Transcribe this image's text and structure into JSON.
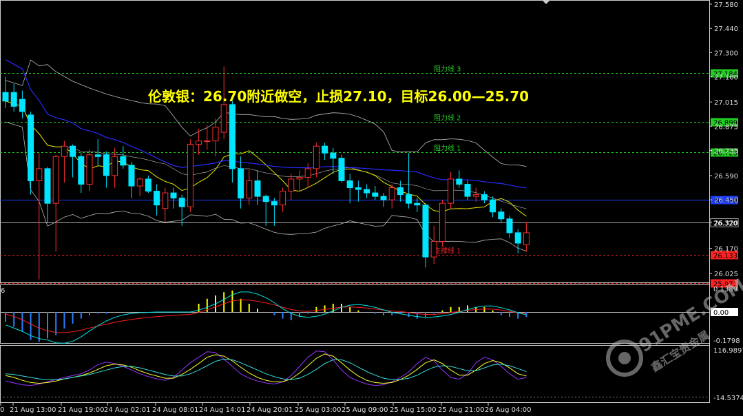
{
  "annotation": {
    "text": "伦敦银：26.70附近做空，止损27.10，目标26.00—25.70",
    "color": "#ffff00"
  },
  "watermark": {
    "brand": "91PME.COM",
    "sub": "鑫汇宝贵金属"
  },
  "price_axis": {
    "ticks": [
      "27.580",
      "27.440",
      "27.300",
      "27.160",
      "27.015",
      "26.875",
      "26.735",
      "26.590",
      "26.450",
      "26.320",
      "26.170",
      "26.025"
    ],
    "tick_values": [
      27.58,
      27.44,
      27.3,
      27.16,
      27.015,
      26.875,
      26.735,
      26.59,
      26.45,
      26.32,
      26.17,
      26.025
    ],
    "range": [
      25.94,
      27.6
    ]
  },
  "levels": [
    {
      "name": "阻力线 3",
      "price": 27.184,
      "badge": "27.184",
      "color": "#22cc22",
      "badge_bg": "#22cc22",
      "style": "dashed"
    },
    {
      "name": "阻力线 2",
      "price": 26.899,
      "badge": "26.899",
      "color": "#22cc22",
      "badge_bg": "#22cc22",
      "style": "dashed"
    },
    {
      "name": "阻力线 1",
      "price": 26.723,
      "badge": "26.723",
      "color": "#22cc22",
      "badge_bg": "#22cc22",
      "style": "dashed"
    },
    {
      "name": "",
      "price": 26.45,
      "badge": "26.450",
      "color": "#1f3fff",
      "badge_bg": "#1f3fff",
      "style": "solid"
    },
    {
      "name": "",
      "price": 26.32,
      "badge": "26.320",
      "color": "#aaaaaa",
      "badge_bg": "#000000",
      "style": "solid"
    },
    {
      "name": "支撑线 1",
      "price": 26.133,
      "badge": "26.133",
      "color": "#ff2222",
      "badge_bg": "#ff2222",
      "style": "dashed"
    },
    {
      "name": "",
      "price": 25.971,
      "badge": "25.971",
      "color": "#ff2222",
      "badge_bg": "#ff2222",
      "style": "dashed"
    }
  ],
  "macd_axis": {
    "top": "0.1389",
    "mid": "0.00",
    "bottom": "-0.1798",
    "left_label": "6"
  },
  "osc_axis": {
    "top": "116.9897",
    "bottom": "-14.5374"
  },
  "time_axis": [
    "0",
    "21 Aug 13:00",
    "21 Aug 19:00",
    "24 Aug 02:01",
    "24 Aug 08:01",
    "24 Aug 14:01",
    "24 Aug 20:01",
    "25 Aug 03:00",
    "25 Aug 09:00",
    "25 Aug 15:00",
    "25 Aug 21:00",
    "26 Aug 04:00"
  ],
  "colors": {
    "bull": "#ff3030",
    "bear": "#00e5ff",
    "ma_fast": "#e6e600",
    "ma_slow": "#2a2aff",
    "bands": "#bbbbbb",
    "macd_pos": "#ffff00",
    "macd_neg": "#2a7fff",
    "signal_red": "#ff2020",
    "signal_cyan": "#00e5e5",
    "osc_purple": "#9933ff",
    "osc_yellow": "#ffff33",
    "osc_cyan": "#33dddd"
  },
  "chart_data": {
    "type": "candlestick",
    "symbol_note": "London silver",
    "candles": [
      {
        "o": 27.07,
        "h": 27.16,
        "l": 26.98,
        "c": 27.02
      },
      {
        "o": 27.07,
        "h": 27.12,
        "l": 26.96,
        "c": 26.99
      },
      {
        "o": 27.03,
        "h": 27.08,
        "l": 26.92,
        "c": 26.96
      },
      {
        "o": 26.94,
        "h": 26.96,
        "l": 26.48,
        "c": 26.56
      },
      {
        "o": 26.56,
        "h": 26.72,
        "l": 25.99,
        "c": 26.63
      },
      {
        "o": 26.63,
        "h": 26.64,
        "l": 26.32,
        "c": 26.43
      },
      {
        "o": 26.43,
        "h": 26.71,
        "l": 26.15,
        "c": 26.7
      },
      {
        "o": 26.7,
        "h": 26.79,
        "l": 26.55,
        "c": 26.76
      },
      {
        "o": 26.76,
        "h": 26.77,
        "l": 26.58,
        "c": 26.7
      },
      {
        "o": 26.7,
        "h": 26.72,
        "l": 26.49,
        "c": 26.54
      },
      {
        "o": 26.54,
        "h": 26.74,
        "l": 26.5,
        "c": 26.71
      },
      {
        "o": 26.71,
        "h": 26.8,
        "l": 26.65,
        "c": 26.7
      },
      {
        "o": 26.71,
        "h": 26.73,
        "l": 26.52,
        "c": 26.59
      },
      {
        "o": 26.59,
        "h": 26.75,
        "l": 26.52,
        "c": 26.7
      },
      {
        "o": 26.7,
        "h": 26.76,
        "l": 26.63,
        "c": 26.65
      },
      {
        "o": 26.65,
        "h": 26.67,
        "l": 26.46,
        "c": 26.53
      },
      {
        "o": 26.53,
        "h": 26.58,
        "l": 26.47,
        "c": 26.57
      },
      {
        "o": 26.57,
        "h": 26.59,
        "l": 26.49,
        "c": 26.5
      },
      {
        "o": 26.5,
        "h": 26.54,
        "l": 26.36,
        "c": 26.42
      },
      {
        "o": 26.4,
        "h": 26.52,
        "l": 26.32,
        "c": 26.49
      },
      {
        "o": 26.49,
        "h": 26.52,
        "l": 26.4,
        "c": 26.46
      },
      {
        "o": 26.46,
        "h": 26.48,
        "l": 26.3,
        "c": 26.41
      },
      {
        "o": 26.41,
        "h": 26.8,
        "l": 26.38,
        "c": 26.77
      },
      {
        "o": 26.77,
        "h": 26.86,
        "l": 26.71,
        "c": 26.79
      },
      {
        "o": 26.79,
        "h": 26.88,
        "l": 26.74,
        "c": 26.79
      },
      {
        "o": 26.79,
        "h": 26.92,
        "l": 26.7,
        "c": 26.87
      },
      {
        "o": 26.84,
        "h": 27.22,
        "l": 26.8,
        "c": 27.0
      },
      {
        "o": 27.0,
        "h": 27.02,
        "l": 26.55,
        "c": 26.63
      },
      {
        "o": 26.63,
        "h": 26.7,
        "l": 26.4,
        "c": 26.46
      },
      {
        "o": 26.46,
        "h": 26.62,
        "l": 26.42,
        "c": 26.56
      },
      {
        "o": 26.56,
        "h": 26.62,
        "l": 26.42,
        "c": 26.47
      },
      {
        "o": 26.47,
        "h": 26.48,
        "l": 26.3,
        "c": 26.44
      },
      {
        "o": 26.44,
        "h": 26.46,
        "l": 26.3,
        "c": 26.42
      },
      {
        "o": 26.42,
        "h": 26.52,
        "l": 26.38,
        "c": 26.5
      },
      {
        "o": 26.5,
        "h": 26.6,
        "l": 26.45,
        "c": 26.57
      },
      {
        "o": 26.57,
        "h": 26.62,
        "l": 26.5,
        "c": 26.58
      },
      {
        "o": 26.58,
        "h": 26.66,
        "l": 26.52,
        "c": 26.63
      },
      {
        "o": 26.63,
        "h": 26.78,
        "l": 26.58,
        "c": 26.76
      },
      {
        "o": 26.76,
        "h": 26.78,
        "l": 26.68,
        "c": 26.72
      },
      {
        "o": 26.72,
        "h": 26.75,
        "l": 26.6,
        "c": 26.69
      },
      {
        "o": 26.69,
        "h": 26.71,
        "l": 26.55,
        "c": 26.56
      },
      {
        "o": 26.56,
        "h": 26.6,
        "l": 26.43,
        "c": 26.52
      },
      {
        "o": 26.52,
        "h": 26.56,
        "l": 26.44,
        "c": 26.51
      },
      {
        "o": 26.51,
        "h": 26.54,
        "l": 26.46,
        "c": 26.49
      },
      {
        "o": 26.49,
        "h": 26.53,
        "l": 26.45,
        "c": 26.47
      },
      {
        "o": 26.47,
        "h": 26.49,
        "l": 26.41,
        "c": 26.45
      },
      {
        "o": 26.45,
        "h": 26.54,
        "l": 26.4,
        "c": 26.52
      },
      {
        "o": 26.52,
        "h": 26.56,
        "l": 26.44,
        "c": 26.48
      },
      {
        "o": 26.48,
        "h": 26.72,
        "l": 26.4,
        "c": 26.43
      },
      {
        "o": 26.43,
        "h": 26.46,
        "l": 26.38,
        "c": 26.42
      },
      {
        "o": 26.42,
        "h": 26.43,
        "l": 26.06,
        "c": 26.12
      },
      {
        "o": 26.12,
        "h": 26.3,
        "l": 26.08,
        "c": 26.21
      },
      {
        "o": 26.21,
        "h": 26.45,
        "l": 26.18,
        "c": 26.43
      },
      {
        "o": 26.43,
        "h": 26.61,
        "l": 26.4,
        "c": 26.57
      },
      {
        "o": 26.57,
        "h": 26.62,
        "l": 26.52,
        "c": 26.54
      },
      {
        "o": 26.54,
        "h": 26.56,
        "l": 26.45,
        "c": 26.47
      },
      {
        "o": 26.47,
        "h": 26.52,
        "l": 26.44,
        "c": 26.48
      },
      {
        "o": 26.48,
        "h": 26.5,
        "l": 26.43,
        "c": 26.45
      },
      {
        "o": 26.45,
        "h": 26.47,
        "l": 26.35,
        "c": 26.38
      },
      {
        "o": 26.38,
        "h": 26.4,
        "l": 26.32,
        "c": 26.34
      },
      {
        "o": 26.34,
        "h": 26.36,
        "l": 26.23,
        "c": 26.26
      },
      {
        "o": 26.26,
        "h": 26.28,
        "l": 26.14,
        "c": 26.2
      },
      {
        "o": 26.19,
        "h": 26.32,
        "l": 26.15,
        "c": 26.26
      }
    ],
    "macd_hist": [
      -0.06,
      -0.09,
      -0.12,
      -0.17,
      -0.18,
      -0.16,
      -0.14,
      -0.1,
      -0.07,
      -0.04,
      -0.02,
      -0.01,
      -0.01,
      0,
      0,
      0,
      0,
      0,
      0,
      0,
      0,
      0,
      0,
      0.05,
      0.08,
      0.1,
      0.12,
      0.13,
      0.08,
      0.05,
      0.02,
      0,
      -0.02,
      -0.04,
      -0.05,
      -0.03,
      -0.01,
      0.03,
      0.04,
      0.05,
      0.05,
      0.03,
      0.01,
      0,
      -0.01,
      -0.02,
      -0.02,
      -0.01,
      -0.03,
      -0.04,
      -0.03,
      -0.01,
      0.01,
      0.03,
      0.03,
      0.04,
      0.03,
      0.03,
      0.01,
      -0.02,
      -0.03,
      -0.04,
      -0.03
    ],
    "osc_k": [
      30,
      25,
      20,
      18,
      22,
      28,
      34,
      40,
      45,
      50,
      60,
      75,
      82,
      78,
      70,
      60,
      50,
      42,
      36,
      32,
      40,
      60,
      80,
      95,
      110,
      108,
      90,
      70,
      50,
      38,
      30,
      25,
      22,
      28,
      45,
      70,
      95,
      112,
      110,
      88,
      60,
      40,
      30,
      22,
      18,
      20,
      28,
      40,
      55,
      78,
      95,
      85,
      60,
      40,
      35,
      50,
      80,
      95,
      88,
      70,
      50,
      35,
      40
    ],
    "osc_d": [
      45,
      40,
      32,
      26,
      24,
      26,
      30,
      36,
      40,
      45,
      52,
      62,
      72,
      76,
      74,
      68,
      58,
      50,
      44,
      38,
      38,
      48,
      62,
      78,
      95,
      102,
      98,
      85,
      68,
      52,
      40,
      32,
      28,
      28,
      36,
      52,
      72,
      92,
      104,
      98,
      80,
      60,
      44,
      32,
      26,
      24,
      26,
      34,
      46,
      62,
      80,
      88,
      78,
      60,
      46,
      46,
      60,
      78,
      86,
      80,
      66,
      50,
      44
    ],
    "osc_s": [
      50,
      48,
      44,
      40,
      36,
      34,
      34,
      36,
      40,
      44,
      48,
      54,
      60,
      66,
      70,
      70,
      66,
      60,
      54,
      48,
      44,
      44,
      50,
      60,
      72,
      84,
      90,
      88,
      80,
      70,
      60,
      50,
      42,
      36,
      34,
      38,
      48,
      62,
      78,
      88,
      88,
      80,
      68,
      56,
      46,
      38,
      34,
      34,
      38,
      46,
      58,
      68,
      72,
      70,
      64,
      58,
      58,
      66,
      74,
      76,
      72,
      64,
      56
    ]
  }
}
